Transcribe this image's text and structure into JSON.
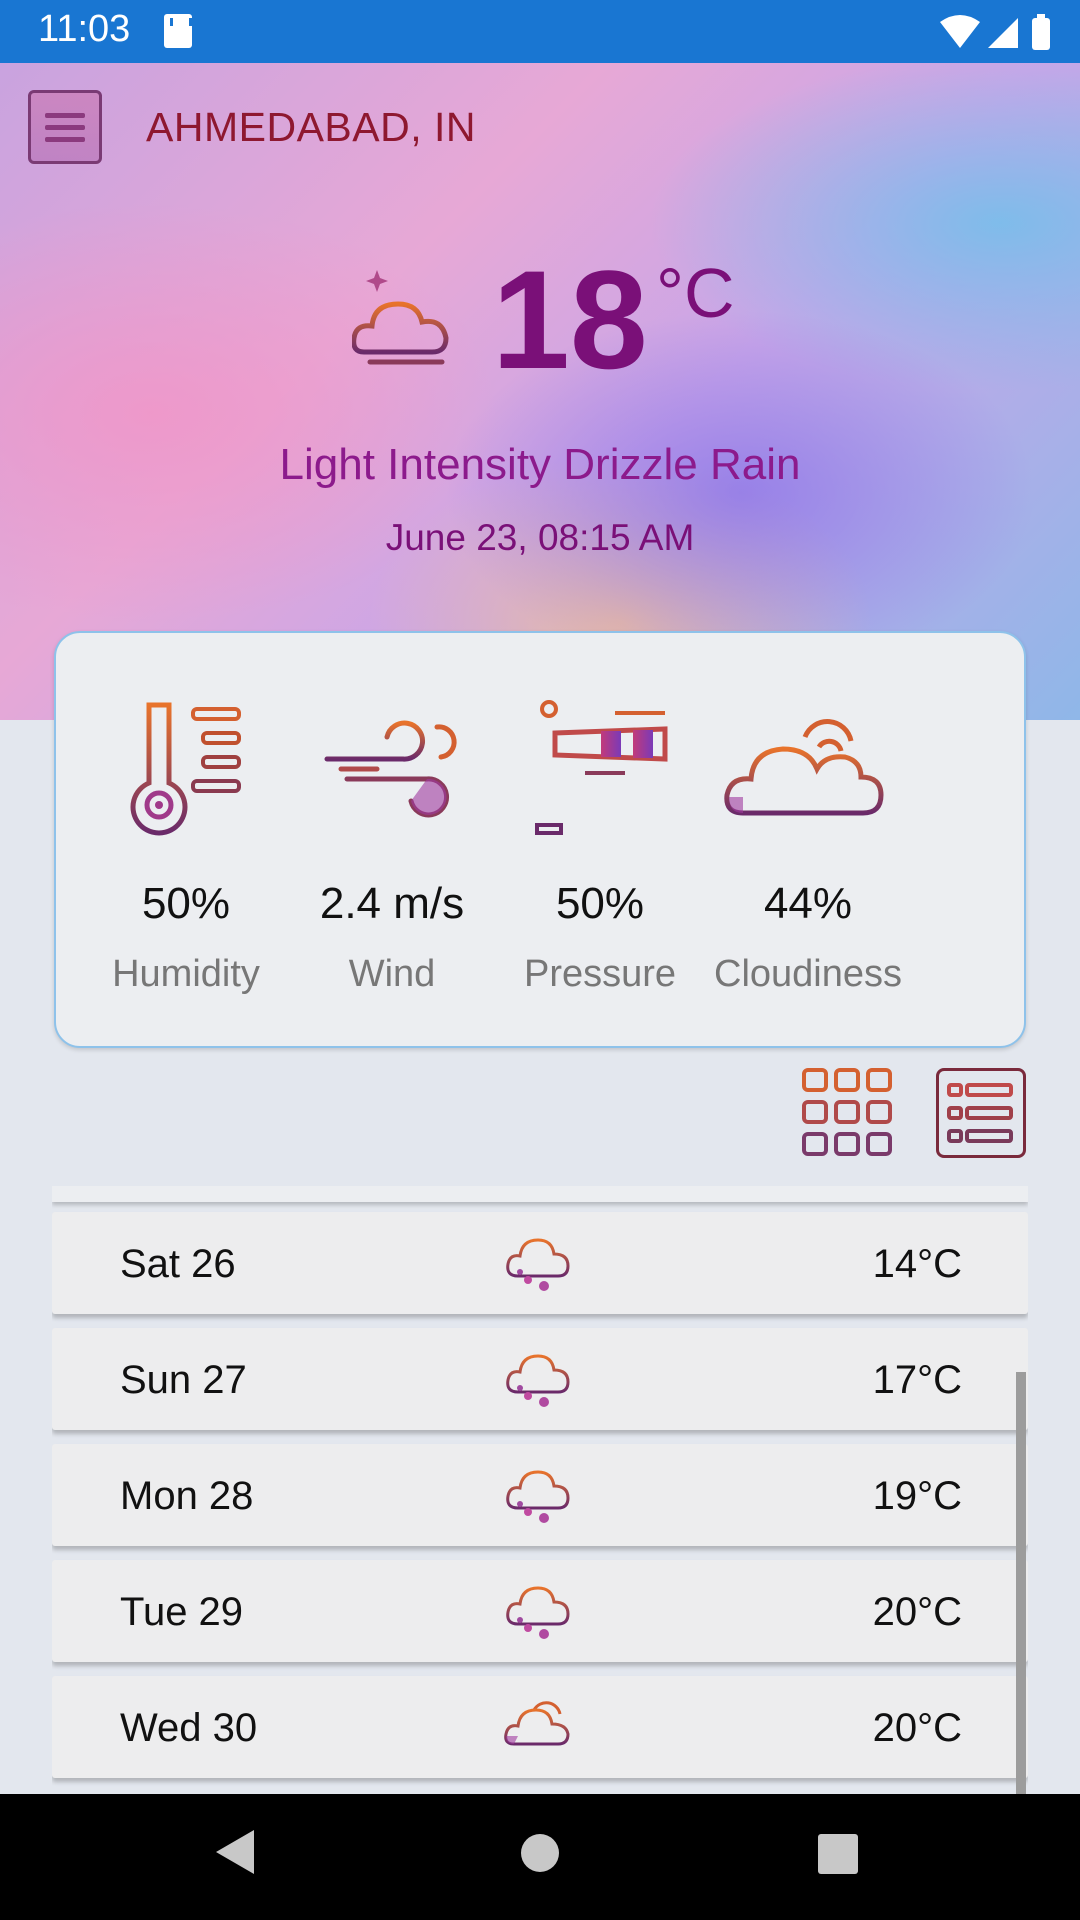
{
  "status_bar": {
    "time": "11:03"
  },
  "header": {
    "city": "AHMEDABAD, IN"
  },
  "current": {
    "temperature": "18",
    "unit": "°C",
    "description": "Light Intensity Drizzle Rain",
    "datetime": "June 23, 08:15 AM",
    "icon": "cloud-moon-icon"
  },
  "stats": [
    {
      "value": "50%",
      "label": "Humidity",
      "icon": "thermometer-icon"
    },
    {
      "value": "2.4 m/s",
      "label": "Wind",
      "icon": "wind-icon"
    },
    {
      "value": "50%",
      "label": "Pressure",
      "icon": "windsock-icon"
    },
    {
      "value": "44%",
      "label": "Cloudiness",
      "icon": "clouds-icon"
    }
  ],
  "view_toggle": {
    "grid": "grid-view-icon",
    "list": "list-view-icon"
  },
  "forecast": [
    {
      "day": "Sat 26",
      "temp": "14°C",
      "icon": "rain-cloud-icon"
    },
    {
      "day": "Sun 27",
      "temp": "17°C",
      "icon": "rain-cloud-icon"
    },
    {
      "day": "Mon 28",
      "temp": "19°C",
      "icon": "rain-cloud-icon"
    },
    {
      "day": "Tue 29",
      "temp": "20°C",
      "icon": "rain-cloud-icon"
    },
    {
      "day": "Wed 30",
      "temp": "20°C",
      "icon": "cloud-icon"
    }
  ],
  "colors": {
    "status_bar": "#1976d2",
    "primary_text": "#7a1078",
    "city": "#8e1830",
    "card_border": "#8ec2ea"
  }
}
